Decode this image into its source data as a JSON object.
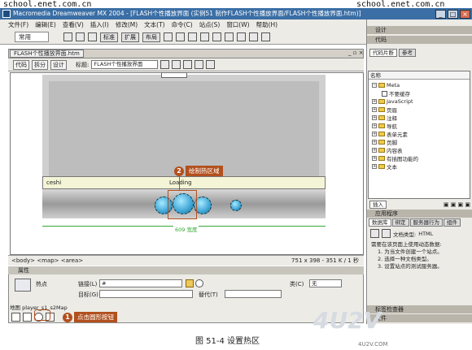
{
  "watermark_top_left": "school.enet.com.cn",
  "watermark_top_right": "school.enet.com.cn",
  "window": {
    "title": "Macromedia Dreamweaver MX 2004 - [FLASH个性播放界面 (实例51 制作FLASH个性播放界面/FLASH个性播放界面.htm)]",
    "buttons": [
      "_",
      "□",
      "×"
    ]
  },
  "menu": [
    "文件(F)",
    "编辑(E)",
    "查看(V)",
    "插入(I)",
    "修改(M)",
    "文本(T)",
    "命令(C)",
    "站点(S)",
    "窗口(W)",
    "帮助(H)"
  ],
  "insertbar": {
    "category": "常用",
    "tabs": [
      "标准",
      "扩展",
      "布局"
    ]
  },
  "document": {
    "tab": "FLASH个性播放界面.htm",
    "view_buttons": [
      "代码",
      "拆分",
      "设计"
    ],
    "title_label": "标题:",
    "title_value": "FLASH个性播放界面",
    "player_text_left": "ceshi",
    "player_text_mid": "Loading",
    "width_label": "609 宽度",
    "status_left": "<body> <map> <area>",
    "status_right": "751 x 398 - 351 K / 1 秒"
  },
  "callouts": [
    {
      "num": "2",
      "text": "绘制热区域"
    },
    {
      "num": "1",
      "text": "点击圆形按钮"
    }
  ],
  "properties": {
    "title": "属性",
    "hotspot_label": "热点",
    "link_label": "链接(L)",
    "link_value": "#",
    "target_label": "目标(G)",
    "alt_label": "替代(T)",
    "class_label": "类(C)",
    "class_value": "无",
    "map_label": "地图",
    "map_value": "player_s1_s2Map"
  },
  "right_panel": {
    "design_header": "设计",
    "code_header": "代码",
    "tabs": [
      "代码片断",
      "参考"
    ],
    "tree_header": "名称",
    "tree_items": [
      {
        "label": "Meta",
        "level": 0,
        "expanded": true
      },
      {
        "label": "不要缓存",
        "level": 1,
        "expanded": false
      },
      {
        "label": "JavaScript",
        "level": 0,
        "expanded": false
      },
      {
        "label": "页眉",
        "level": 0,
        "expanded": false
      },
      {
        "label": "注释",
        "level": 0,
        "expanded": false
      },
      {
        "label": "导航",
        "level": 0,
        "expanded": false
      },
      {
        "label": "表单元素",
        "level": 0,
        "expanded": false
      },
      {
        "label": "页脚",
        "level": 0,
        "expanded": false
      },
      {
        "label": "内容表",
        "level": 0,
        "expanded": false
      },
      {
        "label": "有插图功能的",
        "level": 0,
        "expanded": false
      },
      {
        "label": "文本",
        "level": 0,
        "expanded": false
      }
    ],
    "insert_button": "插入",
    "app_header": "应用程序",
    "app_tabs": [
      "数据库",
      "绑定",
      "服务器行为",
      "组件"
    ],
    "doc_type_label": "文档类型:",
    "doc_type_value": "HTML",
    "instructions_intro": "需要在该页面上使用动态数据:",
    "instructions": [
      "1. 为当文件创建一个站点。",
      "2. 选择一种文档类型。",
      "3. 设置站点的测试服务器。"
    ],
    "tag_header": "标签检查器",
    "files_header": "文件"
  },
  "caption": "图 51-4   设置热区",
  "watermark_bottom": "4U2V",
  "watermark_bottom_small": "4U2V.COM"
}
